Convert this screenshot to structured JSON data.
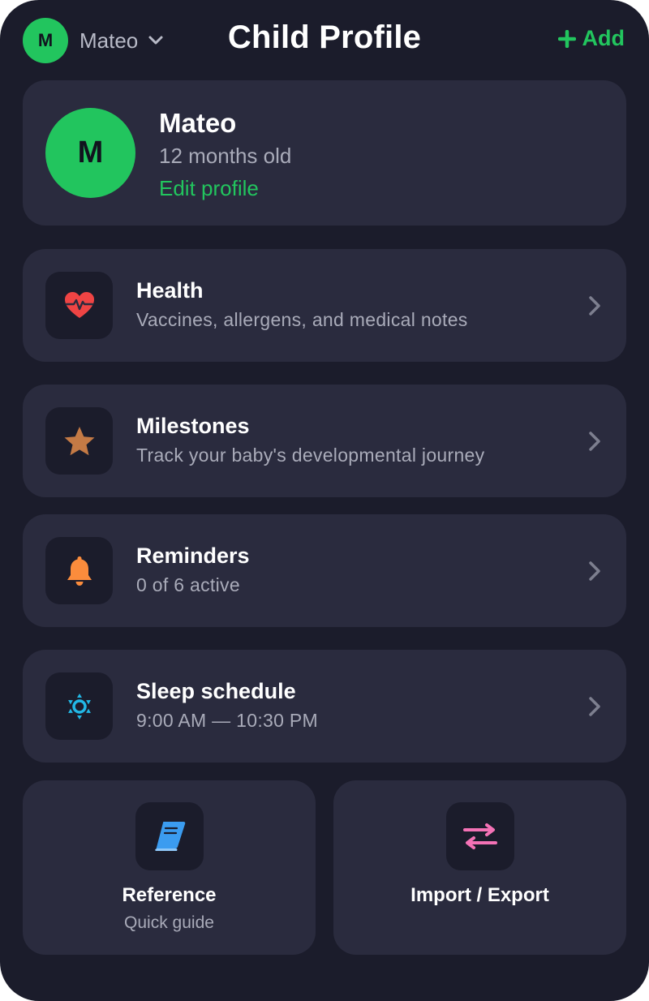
{
  "header": {
    "child_initial": "M",
    "child_name": "Mateo",
    "title": "Child Profile",
    "add_label": "Add"
  },
  "profile": {
    "initial": "M",
    "name": "Mateo",
    "age": "12 months old",
    "edit_label": "Edit profile"
  },
  "rows": [
    {
      "title": "Health",
      "subtitle": "Vaccines, allergens, and medical notes",
      "icon": "heart-pulse-icon"
    },
    {
      "title": "Milestones",
      "subtitle": "Track your baby's developmental journey",
      "icon": "star-icon"
    },
    {
      "title": "Reminders",
      "subtitle": "0 of 6 active",
      "icon": "bell-icon"
    },
    {
      "title": "Sleep schedule",
      "subtitle": "9:00 AM — 10:30 PM",
      "icon": "sun-icon"
    }
  ],
  "tiles": [
    {
      "title": "Reference",
      "subtitle": "Quick guide",
      "icon": "book-icon"
    },
    {
      "title": "Import / Export",
      "icon": "swap-arrows-icon"
    }
  ],
  "colors": {
    "background": "#1b1c2b",
    "card": "#2a2b3e",
    "accent_green": "#22c55e",
    "health_red": "#ef4444",
    "milestone_brown": "#c47a45",
    "reminder_orange": "#fb8c3c",
    "sleep_cyan": "#22b8e6",
    "reference_blue": "#3b9cf0",
    "import_export_pink": "#f472b6"
  }
}
